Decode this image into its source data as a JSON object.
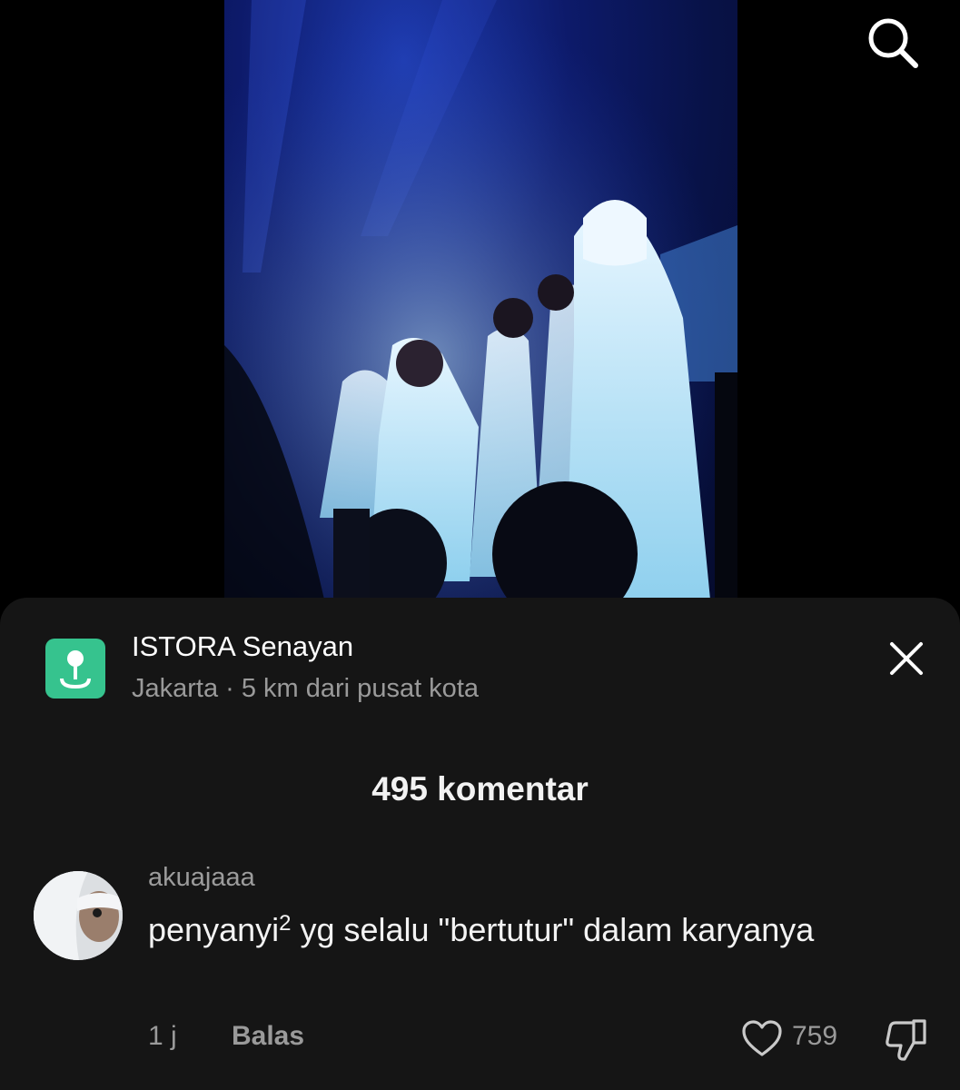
{
  "header": {
    "search_icon": "search-icon"
  },
  "video": {
    "description_icon": "concert-video-frame"
  },
  "location": {
    "icon": "map-pin-icon",
    "name": "ISTORA Senayan",
    "subtitle": "Jakarta · 5 km dari pusat kota",
    "close_icon": "close-icon"
  },
  "comments": {
    "count_label": "495 komentar",
    "items": [
      {
        "username": "akuajaaa",
        "text_before_sup": "penyanyi",
        "sup": "2",
        "text_after_sup": " yg selalu \"bertutur\" dalam karyanya",
        "time": "1 j",
        "reply_label": "Balas",
        "like_icon": "heart-icon",
        "likes": "759",
        "dislike_icon": "thumbs-down-icon"
      }
    ]
  },
  "colors": {
    "sheet_bg": "#151515",
    "location_icon_bg": "#36c38e",
    "muted_text": "#9a9a9a"
  }
}
